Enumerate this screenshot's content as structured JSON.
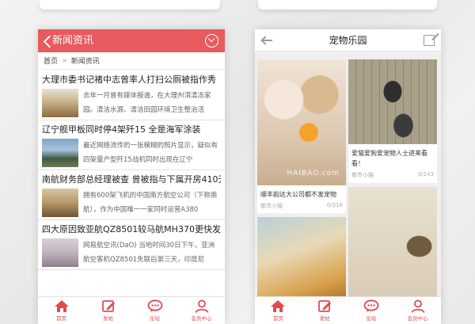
{
  "left_phone": {
    "header_title": "新闻资讯",
    "breadcrumb": {
      "home": "首页",
      "separator": ">",
      "current": "新闻资讯"
    },
    "news": [
      {
        "title": "大理市委书记褚中志曾率人打扫公厕被指作秀",
        "desc": "去年一月曾有媒体报道，在大理州洱清冻家园。清洁水源、清洁田园环境卫生整治活"
      },
      {
        "title": "辽宁舰甲板同时停4架歼15 全是海军涂装",
        "desc": "最近网络流传的一张模糊的照片显示，疑似有四架量产型歼15战机同时出现在辽宁"
      },
      {
        "title": "南航财务部总经理被查 曾被指与下属开房410天",
        "desc": "拥有600架飞机的中国南方航空公司（下称南航），作为中国唯一一家同时运营A380"
      },
      {
        "title": "四大原因致亚航QZ8501较马航MH370更快发现",
        "desc": "网易航空讯(DaO) 当地时间30日下午，亚洲航空客机QZ8501失联后第三天，印度尼"
      }
    ],
    "tabs": [
      {
        "label": "首页",
        "icon": "home-icon"
      },
      {
        "label": "发帖",
        "icon": "edit-icon"
      },
      {
        "label": "论坛",
        "icon": "chat-bubble-icon"
      },
      {
        "label": "会员中心",
        "icon": "user-icon"
      }
    ]
  },
  "right_phone": {
    "header_title": "宠物乐园",
    "watermark": "HAIBAO.com",
    "cards": [
      {
        "caption": "顺丰韵达大公司都不发宠物",
        "source": "都市小猫",
        "count": "0/316"
      },
      {
        "caption": "爱猫爱狗爱宠物人士进来看看！",
        "source": "都市小猫",
        "count": "0/143"
      }
    ],
    "tabs": [
      {
        "label": "首页",
        "icon": "home-icon"
      },
      {
        "label": "发帖",
        "icon": "edit-icon"
      },
      {
        "label": "论坛",
        "icon": "chat-bubble-icon"
      },
      {
        "label": "会员中心",
        "icon": "user-icon"
      }
    ]
  },
  "colors": {
    "accent": "#e85a5e",
    "tab_red": "#e34a4f"
  }
}
